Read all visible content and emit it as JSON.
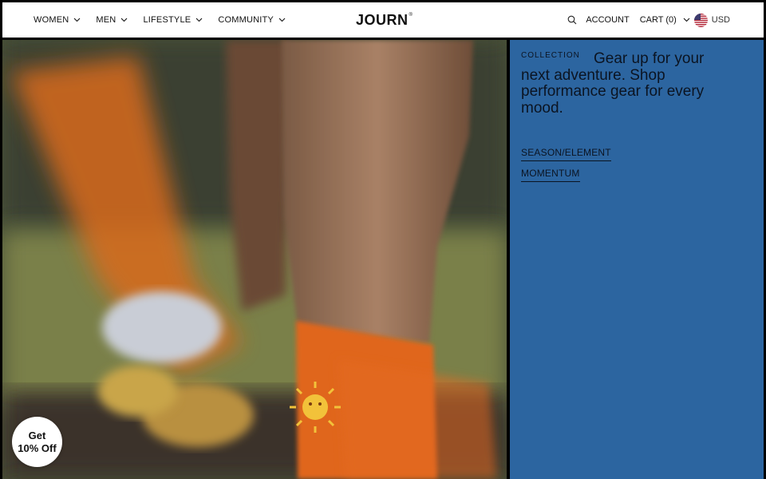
{
  "header": {
    "nav": [
      {
        "label": "WOMEN"
      },
      {
        "label": "MEN"
      },
      {
        "label": "LIFESTYLE"
      },
      {
        "label": "COMMUNITY"
      }
    ],
    "logo": "JOURN",
    "logo_mark": "®",
    "account_label": "ACCOUNT",
    "cart_label": "CART (0)",
    "currency": "USD"
  },
  "hero": {
    "image_description": "Close-up of a runner's leg wearing an orange sock with a sun graphic"
  },
  "panel": {
    "eyebrow": "COLLECTION",
    "headline": "Gear up for your next adventure. Shop performance gear for every mood.",
    "links": [
      {
        "label": "SEASON/ELEMENT"
      },
      {
        "label": "MOMENTUM"
      }
    ],
    "background_color": "#2c65a0"
  },
  "badge": {
    "line1": "Get",
    "line2": "10% Off"
  }
}
